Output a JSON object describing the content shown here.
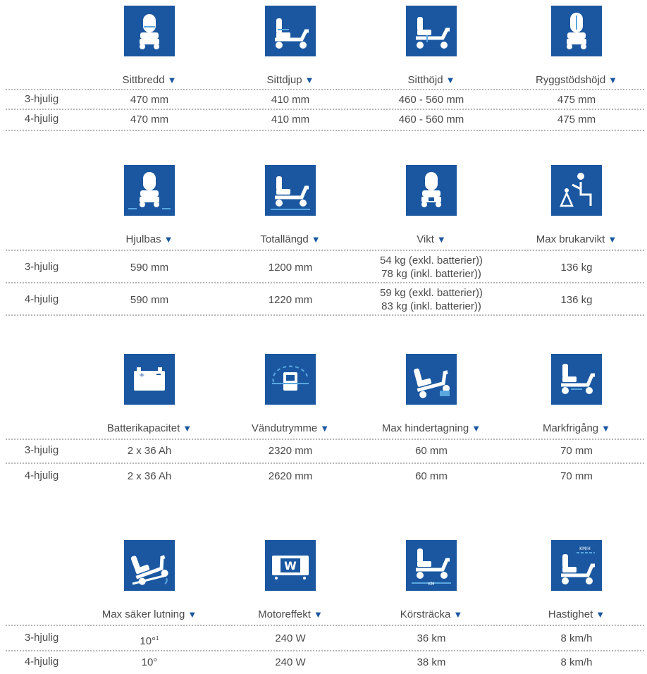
{
  "theme": {
    "icon_bg": "#1a57a0",
    "arrow": "#1a57a0",
    "text": "#4a4a4a",
    "divider": "#b5b5b5"
  },
  "row_labels": [
    "3-hjulig",
    "4-hjulig"
  ],
  "arrow_glyph": "▼",
  "sections": [
    {
      "headers": [
        {
          "label": "Sittbredd",
          "icon": "seat-width-icon"
        },
        {
          "label": "Sittdjup",
          "icon": "seat-depth-icon"
        },
        {
          "label": "Sitthöjd",
          "icon": "seat-height-icon"
        },
        {
          "label": "Ryggstödshöjd",
          "icon": "backrest-height-icon"
        }
      ],
      "rows": [
        [
          [
            "470 mm"
          ],
          [
            "410 mm"
          ],
          [
            "460 - 560 mm"
          ],
          [
            "475 mm"
          ]
        ],
        [
          [
            "470 mm"
          ],
          [
            "410 mm"
          ],
          [
            "460 - 560 mm"
          ],
          [
            "475 mm"
          ]
        ]
      ]
    },
    {
      "headers": [
        {
          "label": "Hjulbas",
          "icon": "wheelbase-icon"
        },
        {
          "label": "Totallängd",
          "icon": "total-length-icon"
        },
        {
          "label": "Vikt",
          "icon": "weight-icon"
        },
        {
          "label": "Max brukarvikt",
          "icon": "max-user-weight-icon"
        }
      ],
      "rows": [
        [
          [
            "590 mm"
          ],
          [
            "1200 mm"
          ],
          [
            "54 kg (exkl. batterier))",
            "78 kg (inkl. batterier))"
          ],
          [
            "136 kg"
          ]
        ],
        [
          [
            "590 mm"
          ],
          [
            "1220 mm"
          ],
          [
            "59 kg (exkl. batterier))",
            "83 kg (inkl. batterier))"
          ],
          [
            "136 kg"
          ]
        ]
      ]
    },
    {
      "headers": [
        {
          "label": "Batterikapacitet",
          "icon": "battery-icon"
        },
        {
          "label": "Vändutrymme",
          "icon": "turning-space-icon"
        },
        {
          "label": "Max hindertagning",
          "icon": "obstacle-climb-icon"
        },
        {
          "label": "Markfrigång",
          "icon": "ground-clearance-icon"
        }
      ],
      "rows": [
        [
          [
            "2 x 36 Ah"
          ],
          [
            "2320 mm"
          ],
          [
            "60 mm"
          ],
          [
            "70 mm"
          ]
        ],
        [
          [
            "2 x 36 Ah"
          ],
          [
            "2620 mm"
          ],
          [
            "60 mm"
          ],
          [
            "70 mm"
          ]
        ]
      ]
    },
    {
      "headers": [
        {
          "label": "Max säker lutning",
          "icon": "max-slope-icon"
        },
        {
          "label": "Motoreffekt",
          "icon": "motor-power-icon"
        },
        {
          "label": "Körsträcka",
          "icon": "range-icon"
        },
        {
          "label": "Hastighet",
          "icon": "speed-icon"
        }
      ],
      "rows": [
        [
          [
            "10°"
          ],
          [
            "240 W"
          ],
          [
            "36 km"
          ],
          [
            "8 km/h"
          ]
        ],
        [
          [
            "10°"
          ],
          [
            "240 W"
          ],
          [
            "38 km"
          ],
          [
            "8 km/h"
          ]
        ]
      ],
      "footnote_mark": "1",
      "icon_texts": {
        "motor": "W",
        "range": "KM",
        "speed": "KM/H"
      }
    }
  ]
}
